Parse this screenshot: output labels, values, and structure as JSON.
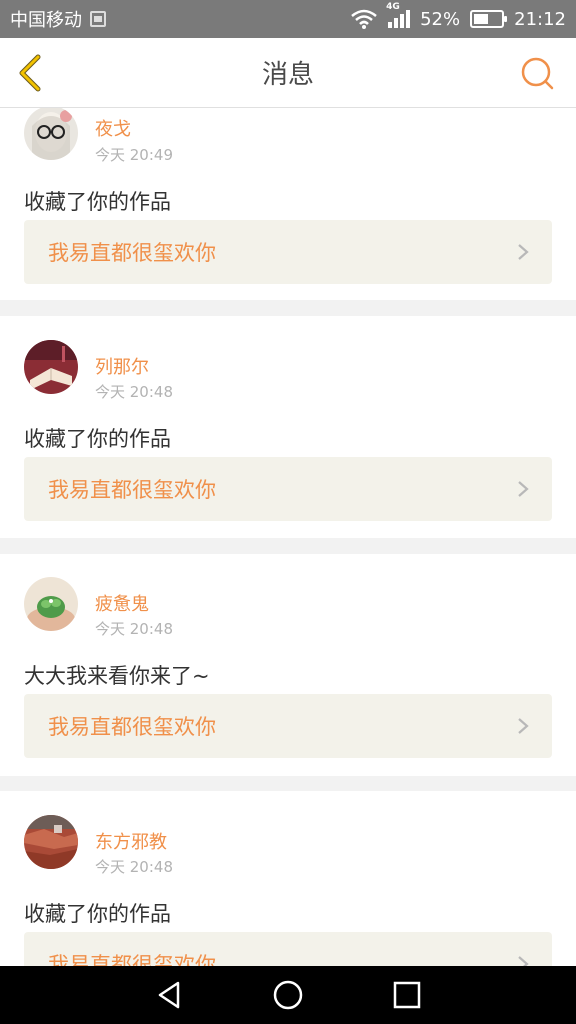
{
  "status_bar": {
    "carrier": "中国移动",
    "network": "4G",
    "battery": "52%",
    "battery_level": 0.52,
    "time": "21:12"
  },
  "header": {
    "title": "消息",
    "accent_color": "#f0904a"
  },
  "messages": [
    {
      "username": "夜戈",
      "time": "今天 20:49",
      "text": "收藏了你的作品",
      "work_title": "我易直都很玺欢你",
      "avatar_icon": "avatar-glasses-girl-icon"
    },
    {
      "username": "列那尔",
      "time": "今天 20:48",
      "text": "收藏了你的作品",
      "work_title": "我易直都很玺欢你",
      "avatar_icon": "avatar-book-icon"
    },
    {
      "username": "疲惫鬼",
      "time": "今天 20:48",
      "text": "大大我来看你来了~",
      "work_title": "我易直都很玺欢你",
      "avatar_icon": "avatar-plant-icon"
    },
    {
      "username": "东方邪教",
      "time": "今天 20:48",
      "text": "收藏了你的作品",
      "work_title": "我易直都很玺欢你",
      "avatar_icon": "avatar-rooftops-icon"
    }
  ]
}
